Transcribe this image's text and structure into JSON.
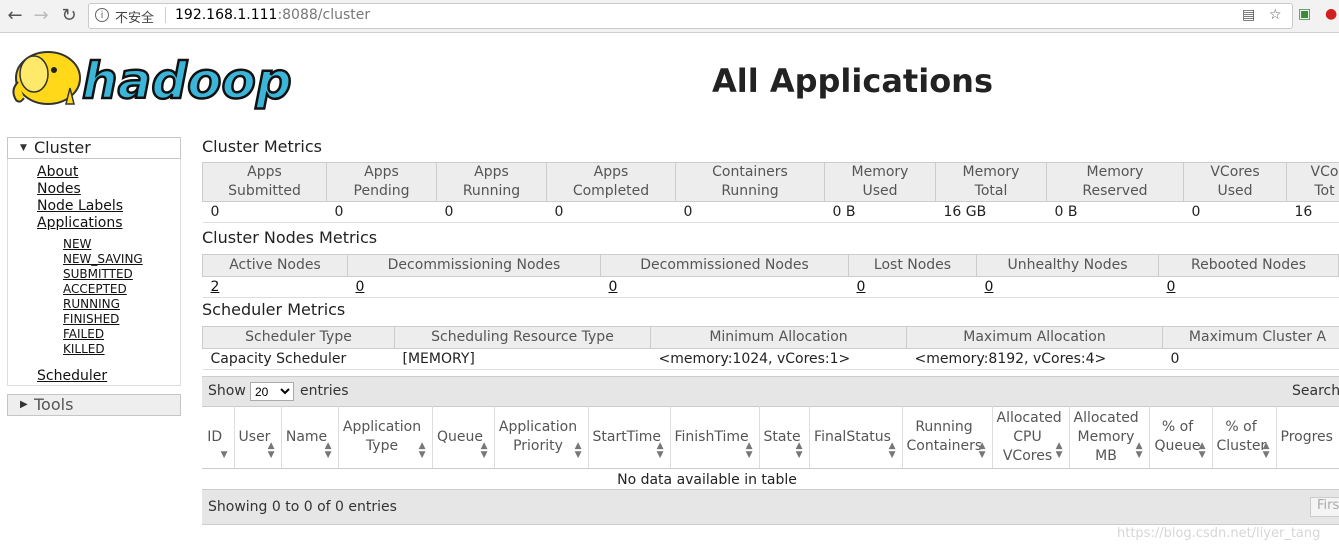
{
  "browser": {
    "security_label": "不安全",
    "url_host": "192.168.1.111",
    "url_path": ":8088/cluster"
  },
  "header": {
    "logo_text": "hadoop",
    "title": "All Applications"
  },
  "sidebar": {
    "cluster_label": "Cluster",
    "links": [
      "About",
      "Nodes",
      "Node Labels",
      "Applications"
    ],
    "app_states": [
      "NEW",
      "NEW_SAVING",
      "SUBMITTED",
      "ACCEPTED",
      "RUNNING",
      "FINISHED",
      "FAILED",
      "KILLED"
    ],
    "scheduler_label": "Scheduler",
    "tools_label": "Tools"
  },
  "cluster_metrics": {
    "title": "Cluster Metrics",
    "headers": [
      [
        "Apps",
        "Submitted"
      ],
      [
        "Apps",
        "Pending"
      ],
      [
        "Apps",
        "Running"
      ],
      [
        "Apps",
        "Completed"
      ],
      [
        "Containers",
        "Running"
      ],
      [
        "Memory",
        "Used"
      ],
      [
        "Memory",
        "Total"
      ],
      [
        "Memory",
        "Reserved"
      ],
      [
        "VCores",
        "Used"
      ],
      [
        "VCo",
        "Tot"
      ]
    ],
    "values": [
      "0",
      "0",
      "0",
      "0",
      "0",
      "0 B",
      "16 GB",
      "0 B",
      "0",
      "16"
    ]
  },
  "nodes_metrics": {
    "title": "Cluster Nodes Metrics",
    "headers": [
      "Active Nodes",
      "Decommissioning Nodes",
      "Decommissioned Nodes",
      "Lost Nodes",
      "Unhealthy Nodes",
      "Rebooted Nodes"
    ],
    "values": [
      "2",
      "0",
      "0",
      "0",
      "0",
      "0"
    ]
  },
  "scheduler_metrics": {
    "title": "Scheduler Metrics",
    "headers": [
      "Scheduler Type",
      "Scheduling Resource Type",
      "Minimum Allocation",
      "Maximum Allocation",
      "Maximum Cluster A"
    ],
    "values": [
      "Capacity Scheduler",
      "[MEMORY]",
      "<memory:1024, vCores:1>",
      "<memory:8192, vCores:4>",
      "0"
    ]
  },
  "apps_table": {
    "show_label": "Show",
    "page_size": "20",
    "entries_label": "entries",
    "search_label": "Search",
    "columns": [
      [
        "ID"
      ],
      [
        "User"
      ],
      [
        "Name"
      ],
      [
        "Application",
        "Type"
      ],
      [
        "Queue"
      ],
      [
        "Application",
        "Priority"
      ],
      [
        "StartTime"
      ],
      [
        "FinishTime"
      ],
      [
        "State"
      ],
      [
        "FinalStatus"
      ],
      [
        "Running",
        "Containers"
      ],
      [
        "Allocated",
        "CPU",
        "VCores"
      ],
      [
        "Allocated",
        "Memory",
        "MB"
      ],
      [
        "% of",
        "Queue"
      ],
      [
        "% of",
        "Cluster"
      ],
      [
        "Progres"
      ]
    ],
    "empty_text": "No data available in table",
    "info_text": "Showing 0 to 0 of 0 entries",
    "first_label": "Firs"
  },
  "watermark": "https://blog.csdn.net/liyer_tang"
}
